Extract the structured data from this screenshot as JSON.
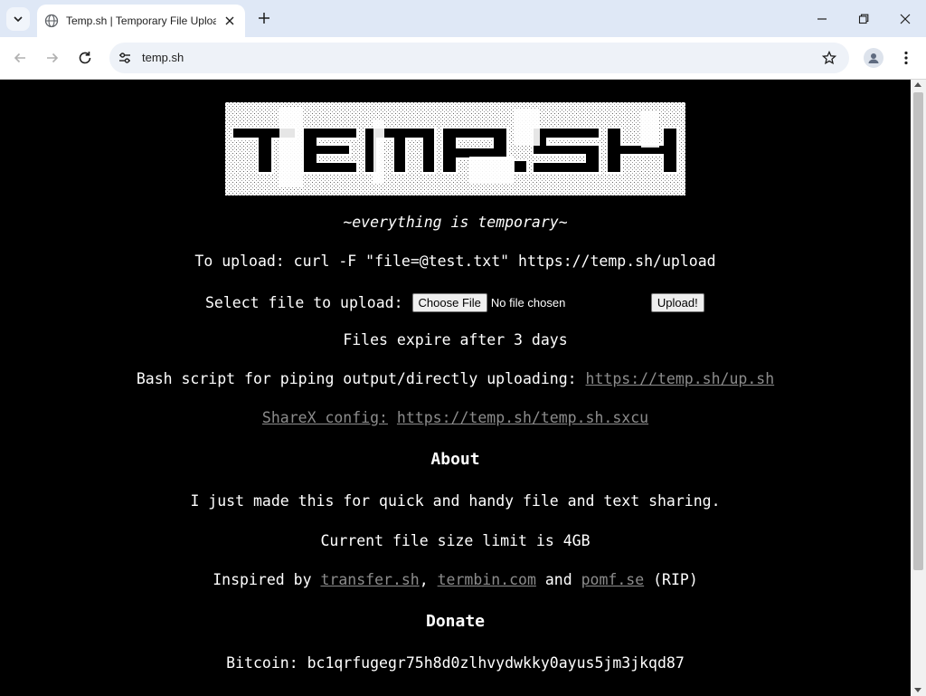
{
  "browser": {
    "tab_title": "Temp.sh | Temporary File Upload",
    "url": "temp.sh"
  },
  "page": {
    "logo_text": "TEMP.SH",
    "tagline": "~everything is temporary~",
    "curl_instruction": "To upload: curl -F \"file=@test.txt\" https://temp.sh/upload",
    "select_label": "Select file to upload:",
    "choose_file": "Choose File",
    "no_file": "No file chosen",
    "upload_button": "Upload!",
    "expire": "Files expire after 3 days",
    "bash_label": "Bash script for piping output/directly uploading:",
    "bash_link": "https://temp.sh/up.sh",
    "sharex_label": "ShareX config:",
    "sharex_link": "https://temp.sh/temp.sh.sxcu",
    "about_heading": "About",
    "about_text": "I just made this for quick and handy file and text sharing.",
    "limit_text": "Current file size limit is 4GB",
    "inspired_prefix": "Inspired by",
    "inspired_link1": "transfer.sh",
    "inspired_sep": ",",
    "inspired_link2": "termbin.com",
    "inspired_and": "and",
    "inspired_link3": "pomf.se",
    "inspired_suffix": "(RIP)",
    "donate_heading": "Donate",
    "bitcoin": "Bitcoin: bc1qrfugegr75h8d0zlhvydwkky0ayus5jm3jkqd87"
  },
  "colors": {
    "page_bg": "#000000",
    "text": "#ffffff",
    "link": "#8c8c8c",
    "tabbar": "#dfe8f6"
  }
}
